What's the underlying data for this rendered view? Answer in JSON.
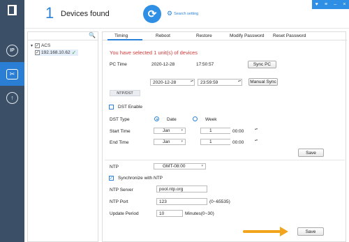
{
  "sidebar": {
    "icons": [
      "logo-icon",
      "ip-icon",
      "tools-icon",
      "upgrade-icon"
    ]
  },
  "header": {
    "count": "1",
    "title": "Devices found",
    "search_setting": "Search setting",
    "window_controls": [
      "♥",
      "≡",
      "–",
      "×"
    ]
  },
  "tree": {
    "root": "ACS",
    "device_ip": "192.168.10.62"
  },
  "tabs": [
    "Timing",
    "Reboot",
    "Restore",
    "Modify Password",
    "Reset Password"
  ],
  "timing": {
    "selected_msg": "You have selected 1 unit(s) of devices",
    "pc_time_label": "PC Time",
    "pc_date": "2020-12-28",
    "pc_time": "17:50:57",
    "sync_pc": "Sync PC",
    "manual_date": "2020-12-28",
    "manual_time": "23:59:59",
    "manual_sync": "Manual Sync"
  },
  "ntpdst": {
    "section": "NTP/DST",
    "dst_enable": "DST Enable",
    "dst_type_label": "DST Type",
    "opt_date": "Date",
    "opt_week": "Week",
    "start_time_label": "Start Time",
    "end_time_label": "End Time",
    "start_month": "Jan",
    "start_day": "1",
    "start_time": "00:00",
    "end_month": "Jan",
    "end_day": "1",
    "end_time": "00:00",
    "save_dst": "Save",
    "ntp_label": "NTP",
    "timezone": "GMT-08:00",
    "sync_ntp": "Synchronize with NTP",
    "ntp_server_label": "NTP Server",
    "ntp_server": "pool.ntp.org",
    "ntp_port_label": "NTP Port",
    "ntp_port": "123",
    "ntp_port_range": "(0~65535)",
    "update_period_label": "Update Period",
    "update_period": "10",
    "update_period_unit": "Minutes(0~30)",
    "save": "Save"
  },
  "colors": {
    "sidebar_bg": "#3b4f66",
    "sidebar_active": "#2a7fd4",
    "accent": "#2a82d8",
    "warning_text": "#d43838",
    "arrow": "#f2a51c"
  }
}
